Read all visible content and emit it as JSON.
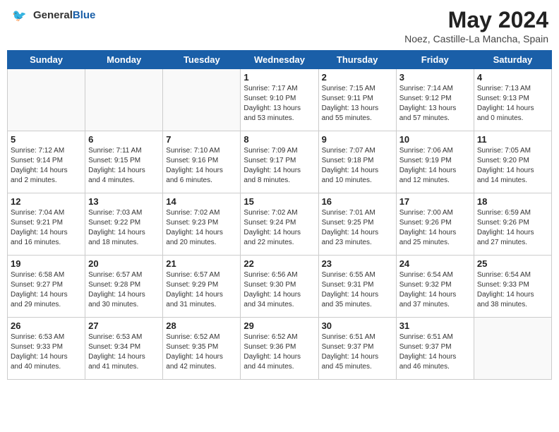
{
  "header": {
    "logo_general": "General",
    "logo_blue": "Blue",
    "month_year": "May 2024",
    "location": "Noez, Castille-La Mancha, Spain"
  },
  "days_of_week": [
    "Sunday",
    "Monday",
    "Tuesday",
    "Wednesday",
    "Thursday",
    "Friday",
    "Saturday"
  ],
  "weeks": [
    [
      {
        "day": "",
        "info": ""
      },
      {
        "day": "",
        "info": ""
      },
      {
        "day": "",
        "info": ""
      },
      {
        "day": "1",
        "info": "Sunrise: 7:17 AM\nSunset: 9:10 PM\nDaylight: 13 hours\nand 53 minutes."
      },
      {
        "day": "2",
        "info": "Sunrise: 7:15 AM\nSunset: 9:11 PM\nDaylight: 13 hours\nand 55 minutes."
      },
      {
        "day": "3",
        "info": "Sunrise: 7:14 AM\nSunset: 9:12 PM\nDaylight: 13 hours\nand 57 minutes."
      },
      {
        "day": "4",
        "info": "Sunrise: 7:13 AM\nSunset: 9:13 PM\nDaylight: 14 hours\nand 0 minutes."
      }
    ],
    [
      {
        "day": "5",
        "info": "Sunrise: 7:12 AM\nSunset: 9:14 PM\nDaylight: 14 hours\nand 2 minutes."
      },
      {
        "day": "6",
        "info": "Sunrise: 7:11 AM\nSunset: 9:15 PM\nDaylight: 14 hours\nand 4 minutes."
      },
      {
        "day": "7",
        "info": "Sunrise: 7:10 AM\nSunset: 9:16 PM\nDaylight: 14 hours\nand 6 minutes."
      },
      {
        "day": "8",
        "info": "Sunrise: 7:09 AM\nSunset: 9:17 PM\nDaylight: 14 hours\nand 8 minutes."
      },
      {
        "day": "9",
        "info": "Sunrise: 7:07 AM\nSunset: 9:18 PM\nDaylight: 14 hours\nand 10 minutes."
      },
      {
        "day": "10",
        "info": "Sunrise: 7:06 AM\nSunset: 9:19 PM\nDaylight: 14 hours\nand 12 minutes."
      },
      {
        "day": "11",
        "info": "Sunrise: 7:05 AM\nSunset: 9:20 PM\nDaylight: 14 hours\nand 14 minutes."
      }
    ],
    [
      {
        "day": "12",
        "info": "Sunrise: 7:04 AM\nSunset: 9:21 PM\nDaylight: 14 hours\nand 16 minutes."
      },
      {
        "day": "13",
        "info": "Sunrise: 7:03 AM\nSunset: 9:22 PM\nDaylight: 14 hours\nand 18 minutes."
      },
      {
        "day": "14",
        "info": "Sunrise: 7:02 AM\nSunset: 9:23 PM\nDaylight: 14 hours\nand 20 minutes."
      },
      {
        "day": "15",
        "info": "Sunrise: 7:02 AM\nSunset: 9:24 PM\nDaylight: 14 hours\nand 22 minutes."
      },
      {
        "day": "16",
        "info": "Sunrise: 7:01 AM\nSunset: 9:25 PM\nDaylight: 14 hours\nand 23 minutes."
      },
      {
        "day": "17",
        "info": "Sunrise: 7:00 AM\nSunset: 9:26 PM\nDaylight: 14 hours\nand 25 minutes."
      },
      {
        "day": "18",
        "info": "Sunrise: 6:59 AM\nSunset: 9:26 PM\nDaylight: 14 hours\nand 27 minutes."
      }
    ],
    [
      {
        "day": "19",
        "info": "Sunrise: 6:58 AM\nSunset: 9:27 PM\nDaylight: 14 hours\nand 29 minutes."
      },
      {
        "day": "20",
        "info": "Sunrise: 6:57 AM\nSunset: 9:28 PM\nDaylight: 14 hours\nand 30 minutes."
      },
      {
        "day": "21",
        "info": "Sunrise: 6:57 AM\nSunset: 9:29 PM\nDaylight: 14 hours\nand 31 minutes."
      },
      {
        "day": "22",
        "info": "Sunrise: 6:56 AM\nSunset: 9:30 PM\nDaylight: 14 hours\nand 34 minutes."
      },
      {
        "day": "23",
        "info": "Sunrise: 6:55 AM\nSunset: 9:31 PM\nDaylight: 14 hours\nand 35 minutes."
      },
      {
        "day": "24",
        "info": "Sunrise: 6:54 AM\nSunset: 9:32 PM\nDaylight: 14 hours\nand 37 minutes."
      },
      {
        "day": "25",
        "info": "Sunrise: 6:54 AM\nSunset: 9:33 PM\nDaylight: 14 hours\nand 38 minutes."
      }
    ],
    [
      {
        "day": "26",
        "info": "Sunrise: 6:53 AM\nSunset: 9:33 PM\nDaylight: 14 hours\nand 40 minutes."
      },
      {
        "day": "27",
        "info": "Sunrise: 6:53 AM\nSunset: 9:34 PM\nDaylight: 14 hours\nand 41 minutes."
      },
      {
        "day": "28",
        "info": "Sunrise: 6:52 AM\nSunset: 9:35 PM\nDaylight: 14 hours\nand 42 minutes."
      },
      {
        "day": "29",
        "info": "Sunrise: 6:52 AM\nSunset: 9:36 PM\nDaylight: 14 hours\nand 44 minutes."
      },
      {
        "day": "30",
        "info": "Sunrise: 6:51 AM\nSunset: 9:37 PM\nDaylight: 14 hours\nand 45 minutes."
      },
      {
        "day": "31",
        "info": "Sunrise: 6:51 AM\nSunset: 9:37 PM\nDaylight: 14 hours\nand 46 minutes."
      },
      {
        "day": "",
        "info": ""
      }
    ]
  ]
}
